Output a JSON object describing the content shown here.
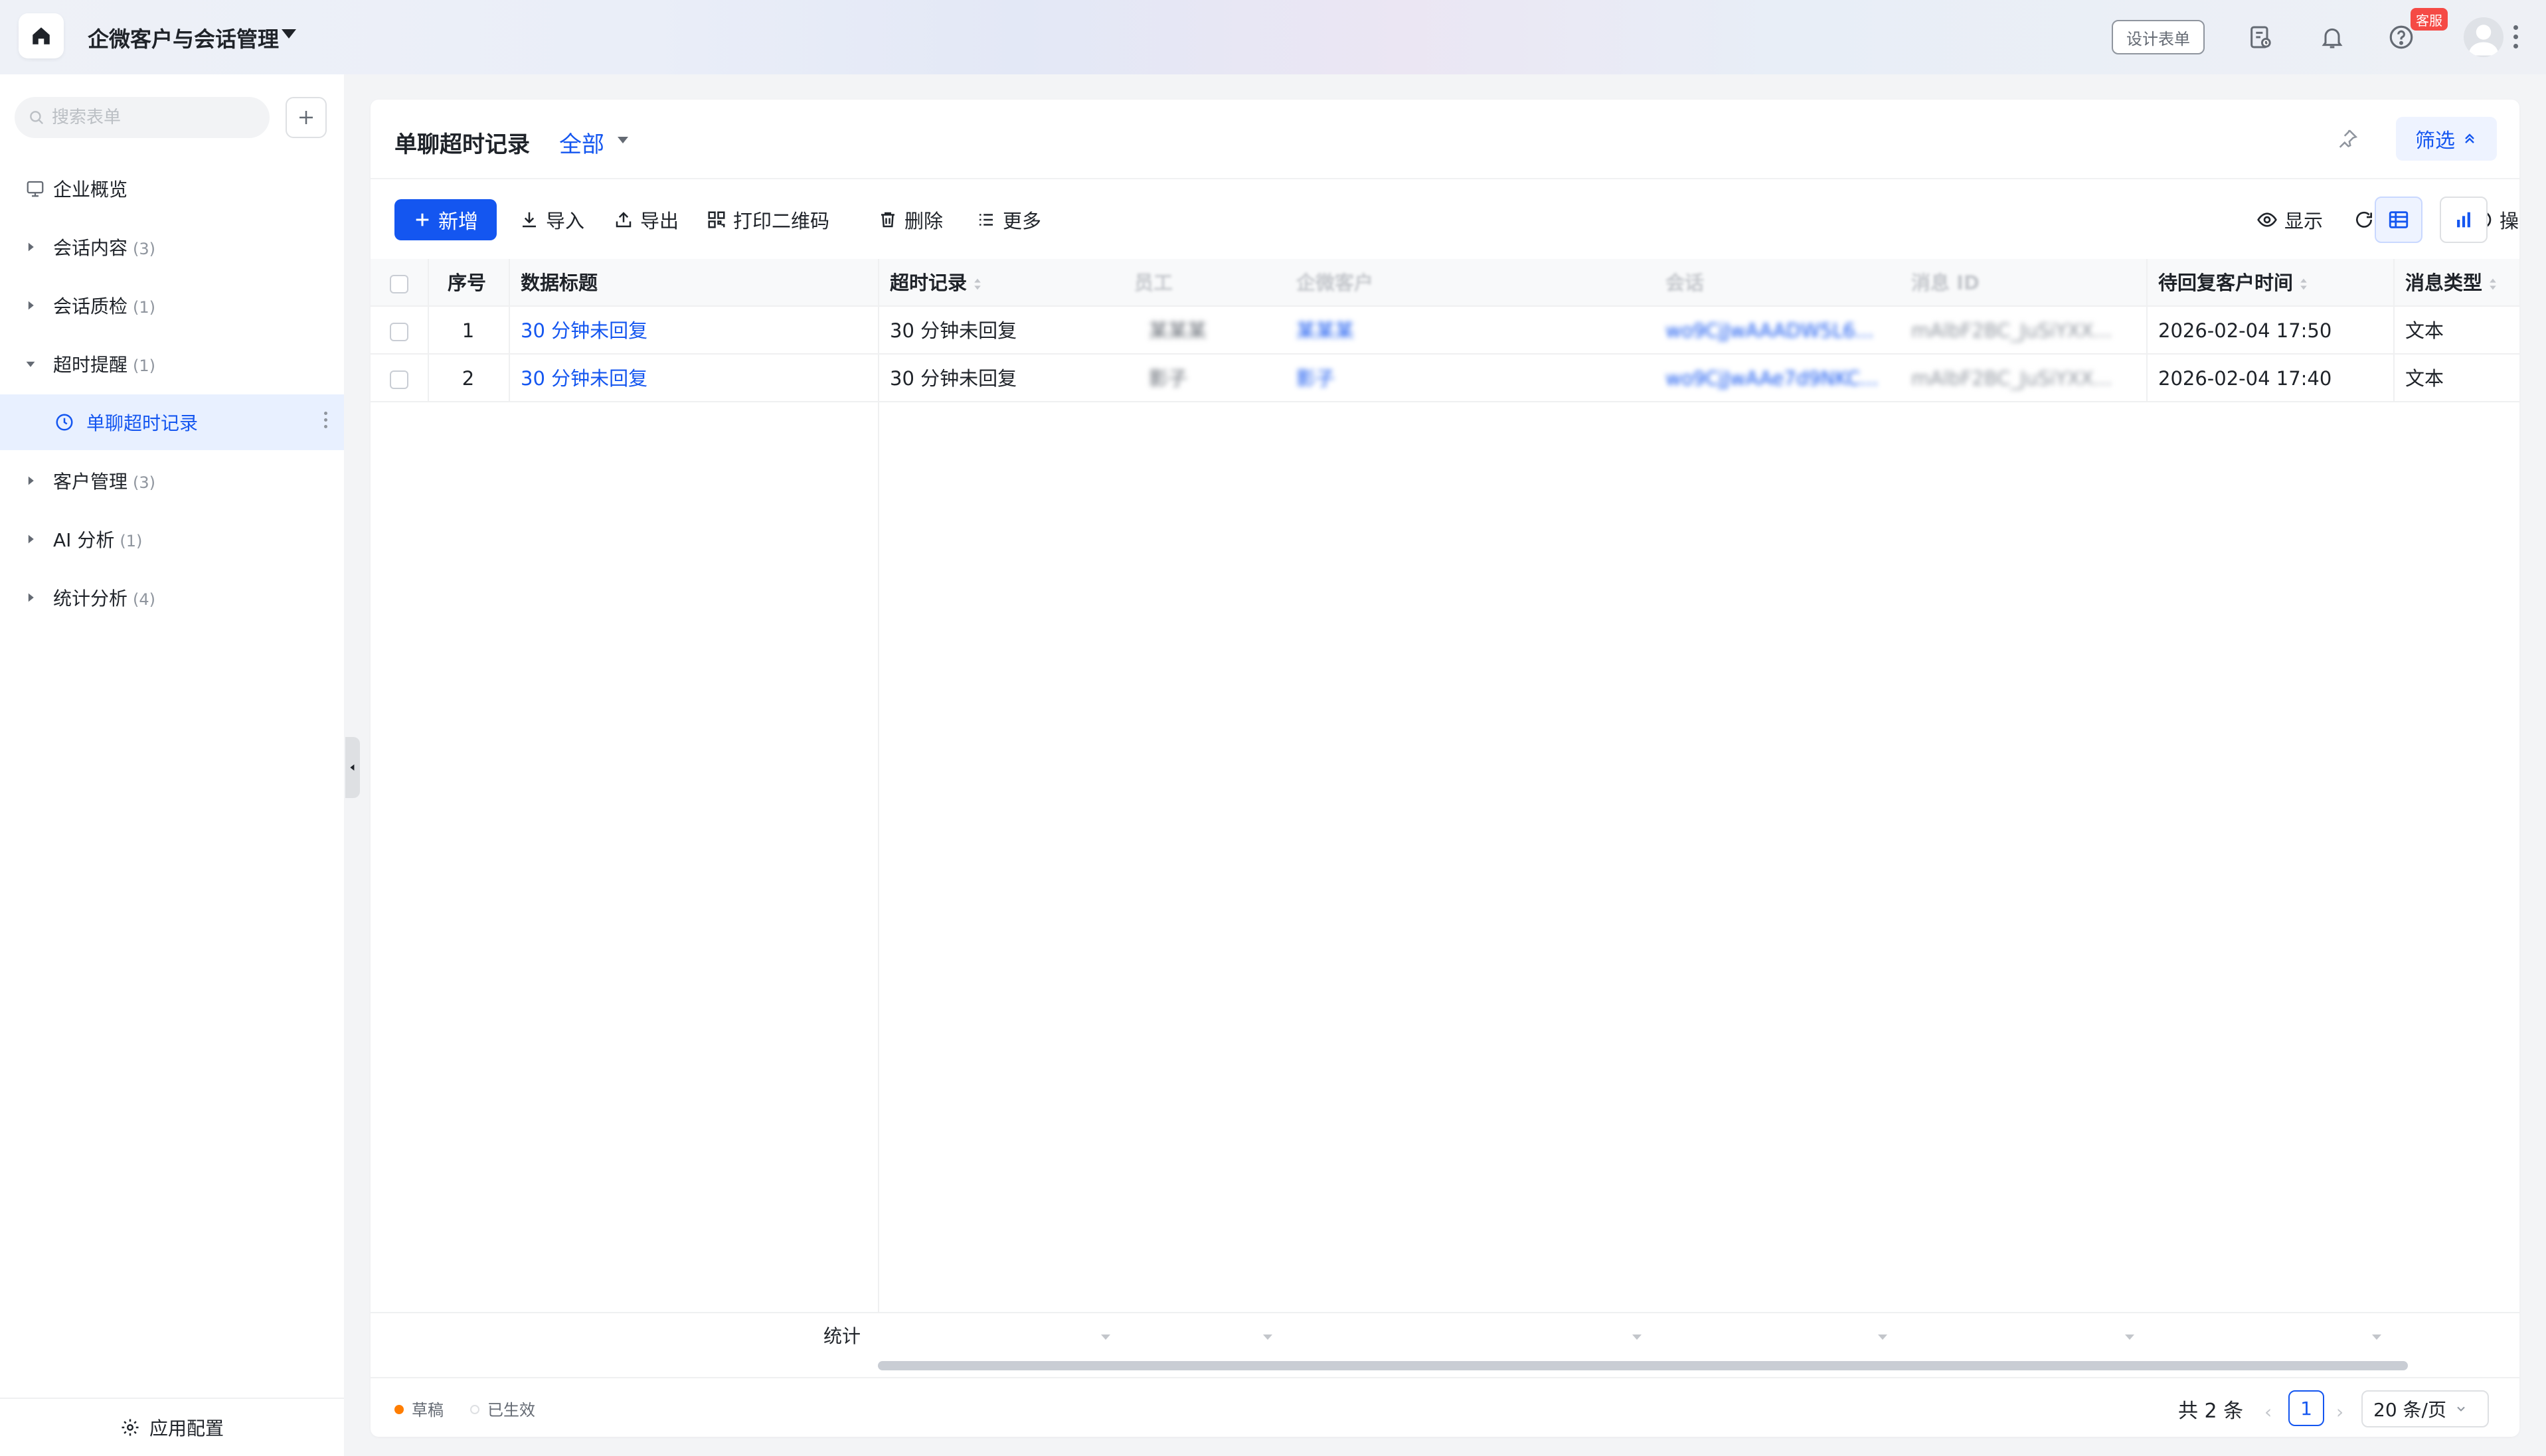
{
  "header": {
    "app_title": "企微客户与会话管理",
    "design_button": "设计表单",
    "new_badge": "客服"
  },
  "sidebar": {
    "search_placeholder": "搜索表单",
    "items": [
      {
        "label": "企业概览",
        "count": ""
      },
      {
        "label": "会话内容",
        "count": "(3)"
      },
      {
        "label": "会话质检",
        "count": "(1)"
      },
      {
        "label": "超时提醒",
        "count": "(1)"
      },
      {
        "label": "单聊超时记录",
        "count": ""
      },
      {
        "label": "客户管理",
        "count": "(3)"
      },
      {
        "label": "AI 分析",
        "count": "(1)"
      },
      {
        "label": "统计分析",
        "count": "(4)"
      }
    ],
    "app_config": "应用配置"
  },
  "view": {
    "title": "单聊超时记录",
    "selector": "全部",
    "filter_button": "筛选"
  },
  "toolbar": {
    "new": "新增",
    "import": "导入",
    "export": "导出",
    "print_qr": "打印二维码",
    "delete": "删除",
    "more": "更多",
    "refresh": "刷新",
    "op_log": "操作记录",
    "display": "显示"
  },
  "table": {
    "columns": [
      "序号",
      "数据标题",
      "超时记录",
      "员工",
      "企微客户",
      "会话",
      "消息 ID",
      "待回复客户时间",
      "消息类型"
    ],
    "rows": [
      {
        "no": "1",
        "title": "30 分钟未回复",
        "timeout": "30 分钟未回复",
        "staff": "某某某",
        "customer": "某某某",
        "session": "wo9CjJwAAADW5L6...",
        "msg_id": "mAlbF2BC_JuSiYXX...",
        "wait_time": "2026-02-04 17:50",
        "msg_type": "文本"
      },
      {
        "no": "2",
        "title": "30 分钟未回复",
        "timeout": "30 分钟未回复",
        "staff": "影子",
        "customer": "影子",
        "session": "wo9CjJwAAe7d9NKC...",
        "msg_id": "mAlbF2BC_JuSiYXX...",
        "wait_time": "2026-02-04 17:40",
        "msg_type": "文本"
      }
    ],
    "stats_label": "统计"
  },
  "footer": {
    "draft": "草稿",
    "effective": "已生效",
    "total": "共 2 条",
    "current_page": "1",
    "page_size": "20 条/页"
  },
  "colors": {
    "primary": "#1456f0",
    "draft_dot": "#ff7d00"
  }
}
